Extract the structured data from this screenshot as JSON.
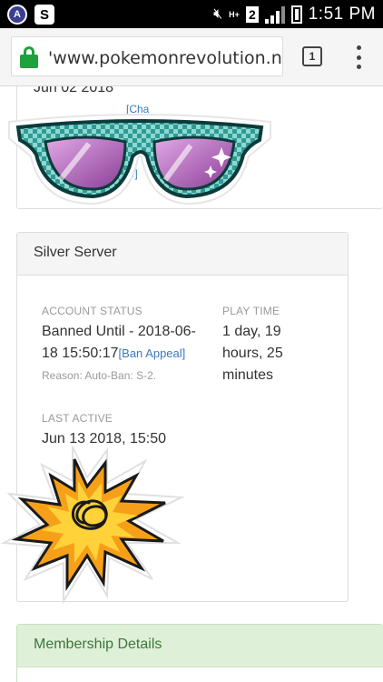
{
  "status_bar": {
    "time": "1:51 PM",
    "network": "H+",
    "sim_number": "2"
  },
  "browser": {
    "url": "'www.pokemonrevolution.net/c",
    "tab_count": "1"
  },
  "top_card": {
    "date": "Jun 02 2018",
    "link1": "[Cha",
    "link2": "ge]"
  },
  "silver_server": {
    "title": "Silver Server",
    "account_status_label": "ACCOUNT STATUS",
    "account_status_line1": "Banned Until - 2018-06-",
    "account_status_line2": "18 15:50:17",
    "ban_appeal": "[Ban Appeal]",
    "reason": "Reason: Auto-Ban: S-2.",
    "play_time_label": "PLAY TIME",
    "play_time_line1": "1 day, 19",
    "play_time_line2": "hours, 25",
    "play_time_line3": "minutes",
    "last_active_label": "LAST ACTIVE",
    "last_active_value": "Jun 13 2018, 15:50"
  },
  "membership": {
    "title": "Membership Details"
  },
  "colors": {
    "link": "#3a79c1",
    "membership_header_bg": "#dff0d8",
    "membership_header_text": "#3c763d",
    "secure_lock": "#1da23e"
  }
}
